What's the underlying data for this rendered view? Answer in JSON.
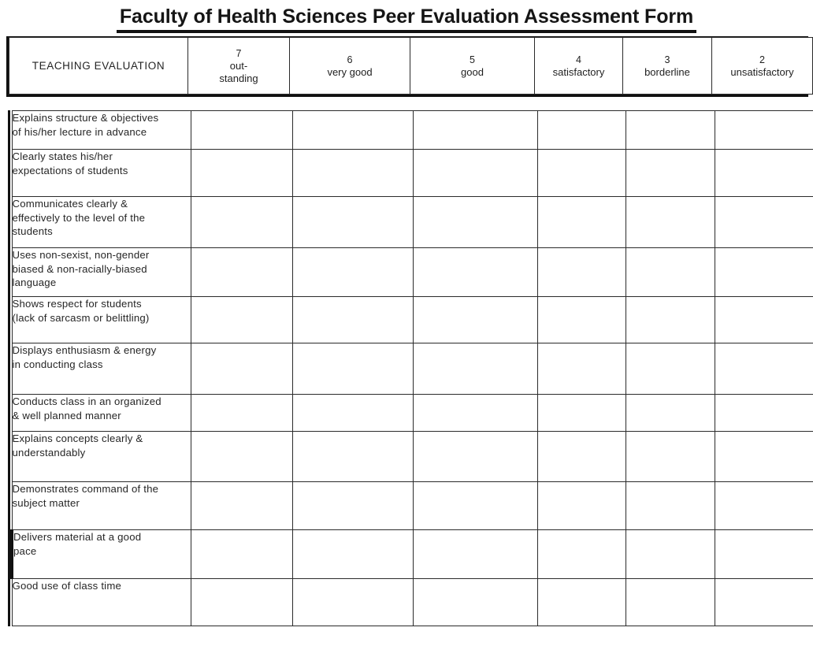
{
  "document": {
    "title": "Faculty of Health Sciences Peer Evaluation Assessment Form"
  },
  "scale_header": {
    "row_label": "TEACHING  EVALUATION",
    "columns": [
      {
        "number": "7",
        "word": "out-\nstanding"
      },
      {
        "number": "6",
        "word": "very good"
      },
      {
        "number": "5",
        "word": "good"
      },
      {
        "number": "4",
        "word": "satisfactory"
      },
      {
        "number": "3",
        "word": "borderline"
      },
      {
        "number": "2",
        "word": "unsatisfactory"
      }
    ]
  },
  "criteria": [
    {
      "label": "Explains  structure & objectives\nof his/her lecture in advance",
      "emphasized": false
    },
    {
      "label": "Clearly  states his/her\nexpectations  of students",
      "emphasized": false
    },
    {
      "label": "Communicates  clearly &\neffectively to the level of the\nstudents",
      "emphasized": false
    },
    {
      "label": "Uses non-sexist, non-gender\nbiased  &  non-racially-biased\nlanguage",
      "emphasized": false
    },
    {
      "label": "Shows respect for students\n(lack of sarcasm  or belittling)",
      "emphasized": false
    },
    {
      "label": "Displays  enthusiasm & energy\nin conducting class",
      "emphasized": false
    },
    {
      "label": "Conducts class  in an organized\n& well planned manner",
      "emphasized": false
    },
    {
      "label": "Explains  concepts clearly &\nunderstandably",
      "emphasized": false
    },
    {
      "label": "Demonstrates  command  of the\nsubject matter",
      "emphasized": false
    },
    {
      "label": "Delivers material  at a good\npace",
      "emphasized": true
    },
    {
      "label": "Good use of class time",
      "emphasized": false
    }
  ],
  "colors": {
    "border": "#2b2b2b",
    "heavy_border": "#111111",
    "text": "#262626",
    "page_background": "#ffffff"
  }
}
